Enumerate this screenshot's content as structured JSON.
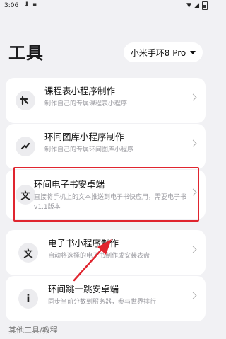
{
  "status": {
    "time": "3:06"
  },
  "header": {
    "title": "工具",
    "device_selector": "小米手环8 Pro"
  },
  "cards": [
    {
      "title": "课程表小程序制作",
      "desc": "制作自己的专属课程表小程序",
      "icon": "T"
    },
    {
      "title": "环间图库小程序制作",
      "desc": "制作自己的专属环间图库小程序",
      "icon": "✓"
    },
    {
      "title": "环间电子书安卓端",
      "desc": "直接将手机上的文本推送到电子书快应用，需要电子书v1.1版本",
      "icon": "文"
    },
    {
      "title": "电子书小程序制作",
      "desc": "自动将选择的电子书制作成安装表盘",
      "icon": "文"
    },
    {
      "title": "环间跳一跳安卓端",
      "desc": "同步当前分数到服务器，参与世界排行",
      "icon": "i"
    }
  ],
  "section": {
    "label": "其他工具/教程"
  },
  "colors": {
    "highlight": "#e0252f",
    "background": "#f1f1f4"
  }
}
